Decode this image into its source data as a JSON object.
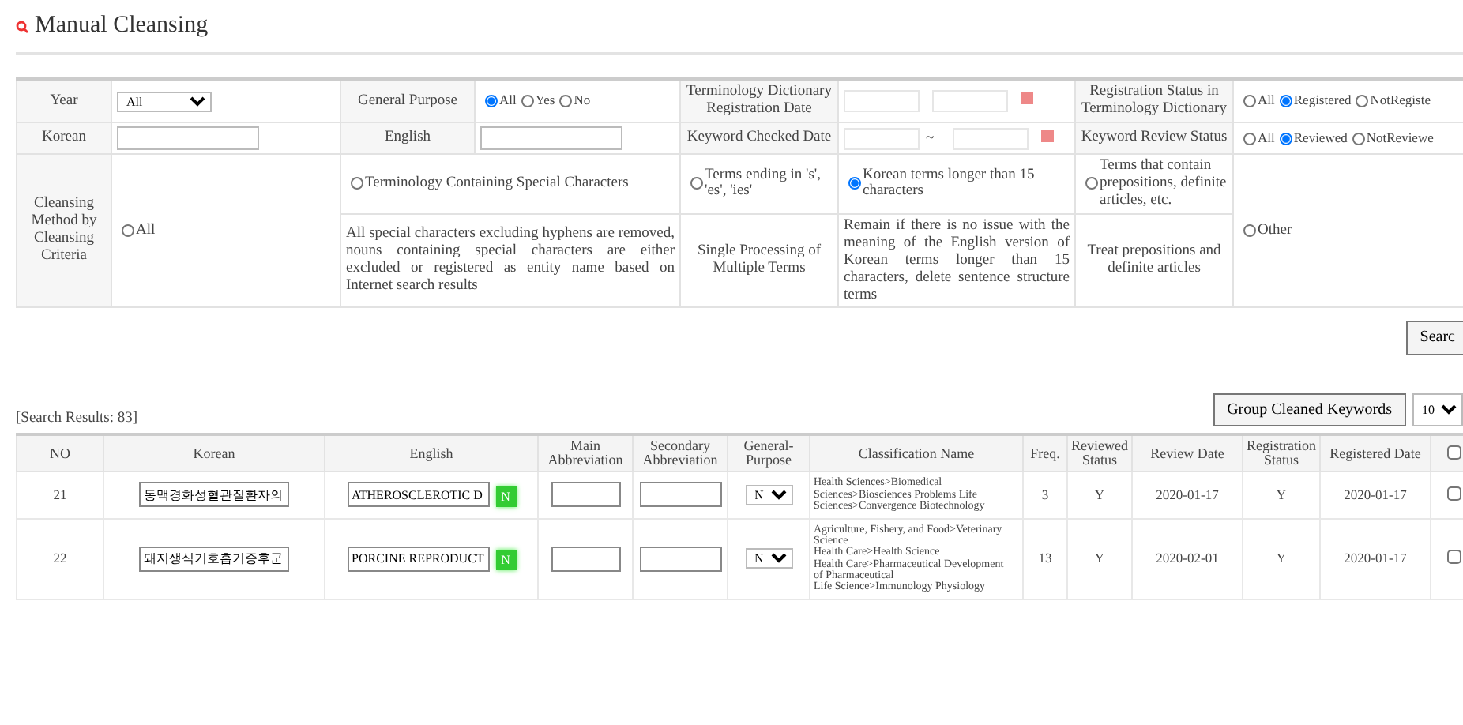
{
  "title": "Manual Cleansing",
  "filters": {
    "year": {
      "label": "Year",
      "value": "All"
    },
    "general_purpose": {
      "label": "General Purpose",
      "options": [
        {
          "label": "All",
          "selected": true
        },
        {
          "label": "Yes",
          "selected": false
        },
        {
          "label": "No",
          "selected": false
        }
      ]
    },
    "registration_date": {
      "label": "Terminology Dictionary Registration Date"
    },
    "registration_status": {
      "label": "Registration Status in Terminology Dictionary",
      "options": [
        {
          "label": "All",
          "selected": false
        },
        {
          "label": "Registered",
          "selected": true
        },
        {
          "label": "NotRegiste",
          "selected": false
        }
      ]
    },
    "korean": {
      "label": "Korean"
    },
    "english": {
      "label": "English"
    },
    "keyword_date": {
      "label": "Keyword Checked Date",
      "separator": "~"
    },
    "review_status": {
      "label": "Keyword Review Status",
      "options": [
        {
          "label": "All",
          "selected": false
        },
        {
          "label": "Reviewed",
          "selected": true
        },
        {
          "label": "NotReviewe",
          "selected": false
        }
      ]
    }
  },
  "cleansing": {
    "label": "Cleansing Method by Cleansing Criteria",
    "methods": [
      {
        "label": "All",
        "selected": false
      },
      {
        "label": "Terminology Containing Special Characters",
        "selected": false,
        "description": "All special characters excluding hyphens are removed, nouns containing special characters are either excluded or registered as entity name based on Internet search results"
      },
      {
        "label": "Terms ending in 's', 'es', 'ies'",
        "selected": false,
        "description": "Single Processing of Multiple Terms"
      },
      {
        "label": "Korean terms longer than 15 characters",
        "selected": true,
        "description": "Remain if there is no issue with the meaning of the English version of Korean terms longer than 15 characters, delete sentence structure terms"
      },
      {
        "label": "Terms that contain prepositions, definite articles, etc.",
        "selected": false,
        "description": "Treat prepositions and definite articles"
      },
      {
        "label": "Other",
        "selected": false
      }
    ]
  },
  "search_button": "Searc",
  "results": {
    "summary": "[Search Results: 83]",
    "group_button": "Group Cleaned Keywords",
    "page_size": "10",
    "select_all_checked": false,
    "columns": [
      "NO",
      "Korean",
      "English",
      "Main Abbreviation",
      "Secondary Abbreviation",
      "General-Purpose",
      "Classification Name",
      "Freq.",
      "Reviewed Status",
      "Review Date",
      "Registration Status",
      "Registered Date"
    ],
    "rows": [
      {
        "no": "21",
        "korean": "동맥경화성혈관질환자의",
        "english": "ATHEROSCLEROTIC D",
        "flag": "N",
        "general_purpose": "N",
        "classification": [
          "Health Sciences>Biomedical",
          "Sciences>Biosciences Problems Life",
          "Sciences>Convergence Biotechnology"
        ],
        "freq": "3",
        "reviewed": "Y",
        "review_date": "2020-01-17",
        "registration": "Y",
        "registered_date": "2020-01-17",
        "checked": false
      },
      {
        "no": "22",
        "korean": "돼지생식기호흡기증후군",
        "english": "PORCINE REPRODUCT",
        "flag": "N",
        "general_purpose": "N",
        "classification": [
          "Agriculture, Fishery, and Food>Veterinary",
          "Science",
          "Health Care>Health Science",
          "Health Care>Pharmaceutical Development",
          "of Pharmaceutical",
          "Life Science>Immunology Physiology"
        ],
        "freq": "13",
        "reviewed": "Y",
        "review_date": "2020-02-01",
        "registration": "Y",
        "registered_date": "2020-01-17",
        "checked": false
      }
    ]
  }
}
